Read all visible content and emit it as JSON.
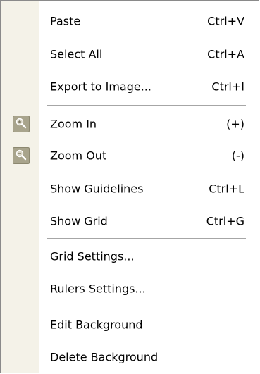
{
  "menu": {
    "groups": [
      [
        {
          "label": "Paste",
          "shortcut": "Ctrl+V"
        },
        {
          "label": "Select All",
          "shortcut": "Ctrl+A"
        },
        {
          "label": "Export to Image...",
          "shortcut": "Ctrl+I"
        }
      ],
      [
        {
          "label": "Zoom In",
          "shortcut": "(+)",
          "icon": "zoom-in-icon"
        },
        {
          "label": "Zoom Out",
          "shortcut": "(-)",
          "icon": "zoom-out-icon"
        },
        {
          "label": "Show Guidelines",
          "shortcut": "Ctrl+L"
        },
        {
          "label": "Show Grid",
          "shortcut": "Ctrl+G"
        }
      ],
      [
        {
          "label": "Grid Settings..."
        },
        {
          "label": "Rulers Settings..."
        }
      ],
      [
        {
          "label": "Edit Background"
        },
        {
          "label": "Delete Background"
        }
      ]
    ]
  },
  "colors": {
    "gutter": "#f4f2e8",
    "icon_bg": "#a8a48c",
    "separator": "#a6a6a6"
  }
}
